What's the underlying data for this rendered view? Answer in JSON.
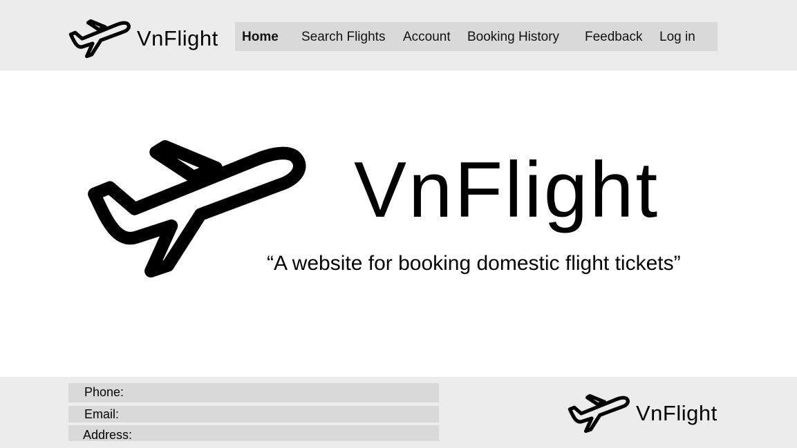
{
  "header": {
    "brand": "VnFlight",
    "logo_icon": "airplane-icon"
  },
  "nav": {
    "items": [
      {
        "label": "Home",
        "active": true
      },
      {
        "label": "Search Flights",
        "active": false
      },
      {
        "label": "Account",
        "active": false
      },
      {
        "label": "Booking History",
        "active": false
      },
      {
        "label": "Feedback",
        "active": false
      },
      {
        "label": "Log in",
        "active": false
      }
    ]
  },
  "hero": {
    "title": "VnFlight",
    "tagline": "“A website for booking domestic flight tickets”",
    "icon": "airplane-icon"
  },
  "footer": {
    "phone_label": "Phone:",
    "email_label": "Email:",
    "address_label": "Address:",
    "brand": "VnFlight",
    "logo_icon": "airplane-icon"
  },
  "colors": {
    "header_bg": "#ececec",
    "nav_bg": "#d9d9d9",
    "footer_bg": "#ececec",
    "field_bg": "#d9d9d9",
    "text": "#000000"
  }
}
